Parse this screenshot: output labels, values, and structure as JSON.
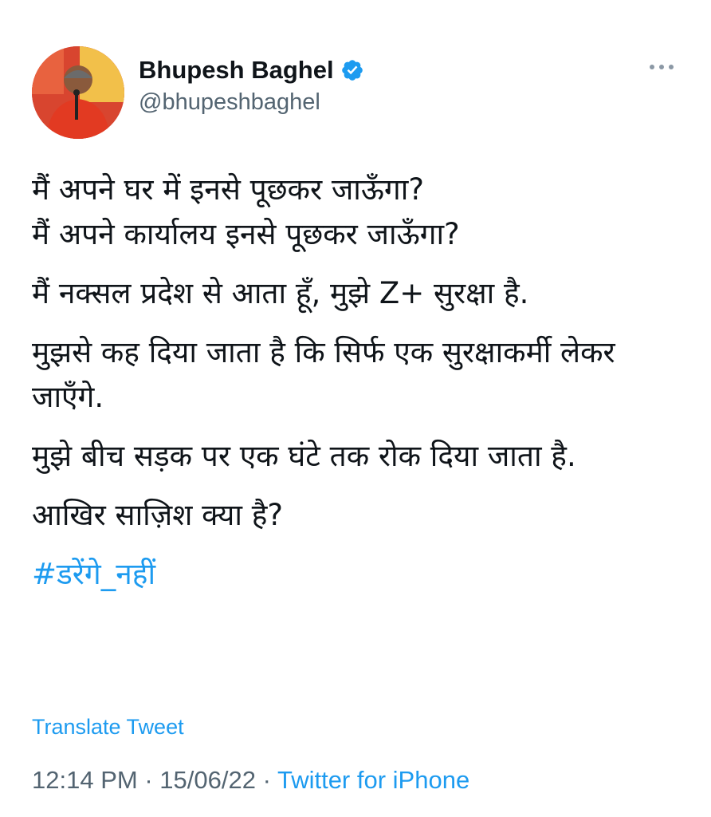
{
  "author": {
    "display_name": "Bhupesh Baghel",
    "handle": "@bhupeshbaghel",
    "verified": true
  },
  "tweet": {
    "lines": [
      "मैं अपने घर में इनसे पूछकर जाऊँगा?",
      "मैं अपने कार्यालय इनसे पूछकर जाऊँगा?",
      "मैं नक्सल प्रदेश से आता हूँ, मुझे Z+ सुरक्षा है.",
      "मुझसे कह दिया जाता है कि सिर्फ एक सुरक्षाकर्मी लेकर जाएँगे.",
      "मुझे बीच सड़क पर एक घंटे तक रोक दिया जाता है.",
      "आखिर साज़िश क्या है?"
    ],
    "hashtag": "#डरेंगे_नहीं"
  },
  "translate_label": "Translate Tweet",
  "meta": {
    "time": "12:14 PM",
    "separator": "·",
    "date": "15/06/22",
    "source": "Twitter for iPhone"
  },
  "colors": {
    "link": "#1d9bf0",
    "secondary_text": "#536471",
    "primary_text": "#0f1419"
  },
  "icons": {
    "verified": "verified-badge-icon",
    "more": "more-options-icon"
  }
}
